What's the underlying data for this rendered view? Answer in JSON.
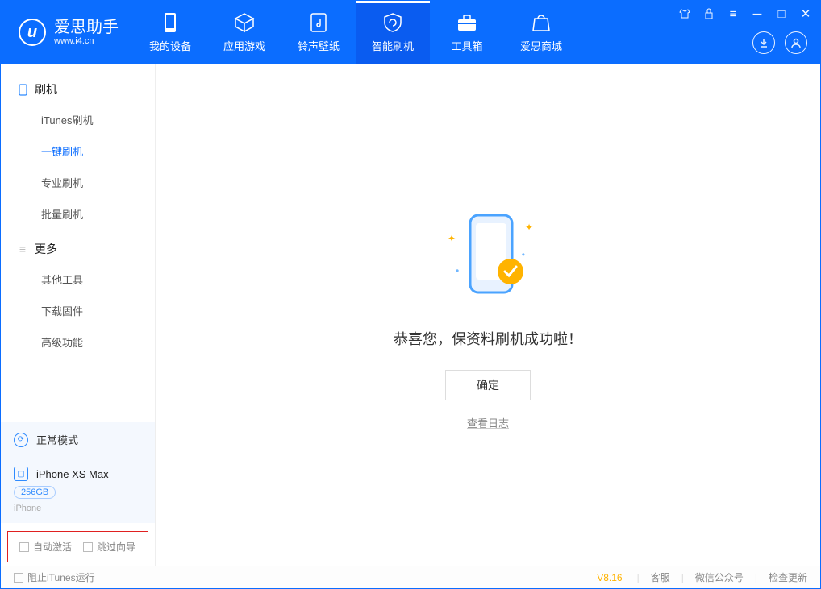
{
  "app": {
    "title": "爱思助手",
    "subtitle": "www.i4.cn"
  },
  "nav": {
    "items": [
      {
        "label": "我的设备"
      },
      {
        "label": "应用游戏"
      },
      {
        "label": "铃声壁纸"
      },
      {
        "label": "智能刷机"
      },
      {
        "label": "工具箱"
      },
      {
        "label": "爱思商城"
      }
    ]
  },
  "sidebar": {
    "group_flash": "刷机",
    "items_flash": [
      {
        "label": "iTunes刷机"
      },
      {
        "label": "一键刷机"
      },
      {
        "label": "专业刷机"
      },
      {
        "label": "批量刷机"
      }
    ],
    "group_more": "更多",
    "items_more": [
      {
        "label": "其他工具"
      },
      {
        "label": "下载固件"
      },
      {
        "label": "高级功能"
      }
    ],
    "mode_label": "正常模式",
    "device_name": "iPhone XS Max",
    "device_storage": "256GB",
    "device_type": "iPhone",
    "auto_activate": "自动激活",
    "skip_guide": "跳过向导"
  },
  "main": {
    "success_msg": "恭喜您，保资料刷机成功啦！",
    "ok_button": "确定",
    "view_log": "查看日志"
  },
  "footer": {
    "block_itunes": "阻止iTunes运行",
    "version": "V8.16",
    "support": "客服",
    "wechat": "微信公众号",
    "check_update": "检查更新"
  }
}
